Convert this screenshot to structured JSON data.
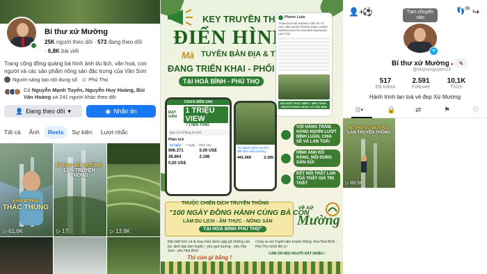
{
  "facebook": {
    "page_name": "Bí thư xứ Mường",
    "followers": "25K",
    "followers_label": "người theo dõi",
    "following": "573",
    "following_label": "đang theo dõi",
    "posts": "6,8K",
    "posts_label": "bài viết",
    "bio": "Trang cộng đồng quảng bá hình ảnh du lịch, văn hoá, con người và các sản phẩm nông sản đặc trưng của Vân Sơn",
    "creator_label": "Người sáng tạo nội dung số",
    "location": "Phú Thọ",
    "mutual_prefix": "Có",
    "mutual_names": "Nguyễn Mạnh Tuyển, Nguyễn Huy Hoàng, Bùi Văn Hoàng",
    "mutual_suffix": "và 241 người khác theo dõi",
    "follow_button": "Đang theo dõi",
    "message_button": "Nhắn tin",
    "tabs": [
      "Tất cả",
      "Ảnh",
      "Reels",
      "Sự kiện",
      "Lượt nhắc"
    ],
    "active_tab": "Reels",
    "reels": [
      {
        "count": "61,6K",
        "overlay_top": "KHÁM PHÁ",
        "overlay_main": "THÁC THUNG"
      },
      {
        "count": "1T",
        "overlay_top": "BÍ THƯ XỨ MƯỜNG",
        "overlay_main": "LAN TRUYỀN THÔNG"
      },
      {
        "count": "13,9K",
        "overlay_top": "",
        "overlay_main": ""
      }
    ],
    "colors": {
      "accent": "#1877f2",
      "active_tab_bg": "#e7f0fd"
    }
  },
  "poster": {
    "line1": "KEY TRUYỀN THÔNG",
    "line2": "ĐIỂN HÌNH",
    "line3_italic": "Mà",
    "line3": "TUYÊN BẢN ĐỊA & TEAM",
    "line4": "ĐANG TRIỂN KHAI - PHỐI HỢP",
    "line5": "TẠI HOÀ BÌNH - PHÚ THỌ",
    "post_author": "Phước Luân",
    "post_text": "THẦN ĐƯỜNG KHÔNG CẦN XE TO HAY CẦN NGHỆ SĨ ĐÌNH ĐÁM, CHÍNH NHỮNG NGƯỜI CON BẢN ĐỊA ĐANG LAN TOẢ",
    "post_caption": "ĐỘI NGŨ THỰC HIỆN 1 NỀN TẢNG - NGƯỜI ĐỒNG HÀNH CÔ VÂN BẢN",
    "stats_header": "CHƯA ĐẾN 24H",
    "stats_pre": "ĐẠT GẦN",
    "stats_main": "1 TRIỆU VIEW",
    "stats_sub": "/ 1 NỀN TẢNG",
    "card_label": "Bạn có 5 thông tin mới.",
    "analysis_label": "Phân tích",
    "analysis_tabs": [
      "24 ngày",
      "7 ngày",
      "Hôm nay"
    ],
    "analysis_values": [
      "906.371",
      "0,00 US$",
      "38.864",
      "2.186",
      "0,00 US$"
    ],
    "mini_caption": "Từ nghèo hiện nay lên đến làm mẫu hướng...",
    "mini_values": [
      "441.568",
      "2.185"
    ],
    "bubbles": [
      "VỚI HÀNG TRĂM, HÀNG NGHÌN LƯỢT BÌNH LUẬN, CHIA SẺ VÀ LAN TOẢ!",
      "HÌNH ẢNH RÕ RÀNG, NỘI DUNG GẦN GŨI",
      "KẾT NỐI THẬT LAN TOẢ THẬT GIÁ TRỊ THẬT"
    ],
    "banner_top": "THUỘC CHIẾN DỊCH TRUYỀN THÔNG",
    "banner_main": "\"100 NGÀY ĐỒNG HÀNH CÙNG BÀ CON",
    "banner_sub": "LÀM DU LỊCH - ẨM THỰC - NÔNG SẢN",
    "banner_place": "TẠI HOÀ BÌNH PHÚ THỌ\"",
    "logo_prefix": "về xứ",
    "logo_main": "Mường",
    "footer_left": "Đặc biệt hơn cả là may mắn được gặp gỡ những cán bộ, lãnh đạo làm huyện - yêu quê hương - yêu Văn Sơn - yêu Hoà Bình",
    "footer_left_sig": "Thì còn gì bằng !",
    "footer_right": "Cùng ve em Tuyển làm truyền thông, đưa Hoà Bình - Phú Thọ mình lên ạ !",
    "footer_right_thanks": "CẢM ƠN MỌI NGƯỜI RẤT NHIỀU !",
    "colors": {
      "green": "#1f5c1f",
      "gold": "#c88a18"
    }
  },
  "tiktok": {
    "tooltip": "Tạm chuyển nào",
    "notif_count": "99",
    "name": "Bí thư xứ Mường",
    "handle": "@duytunguyen23",
    "stats": [
      {
        "value": "517",
        "label": "Đã follow"
      },
      {
        "value": "2.591",
        "label": "Follower"
      },
      {
        "value": "10,1K",
        "label": "Thích"
      }
    ],
    "bio": "Hành trình lan toả vẻ đẹp Xứ Mường",
    "video": {
      "views": "89,5K",
      "overlay_top": "BÍ THƯ XỨ MƯỜNG",
      "overlay_main": "LAN TRUYỀN THÔNG"
    },
    "colors": {
      "plus": "#20a5f0",
      "verified": "#fe2c55"
    }
  }
}
